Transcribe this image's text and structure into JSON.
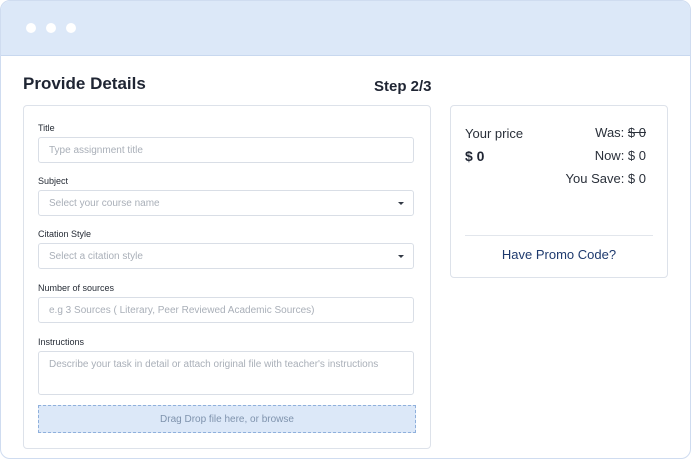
{
  "page": {
    "title": "Provide Details",
    "step": "Step 2/3"
  },
  "form": {
    "title": {
      "label": "Title",
      "placeholder": "Type assignment title",
      "value": ""
    },
    "subject": {
      "label": "Subject",
      "placeholder": "Select your course name",
      "value": ""
    },
    "citation": {
      "label": "Citation Style",
      "placeholder": "Select a citation style",
      "value": ""
    },
    "sources": {
      "label": "Number of sources",
      "placeholder": "e.g 3 Sources ( Literary, Peer Reviewed Academic Sources)",
      "value": ""
    },
    "instructions": {
      "label": "Instructions",
      "placeholder": "Describe your task in detail or attach original file with teacher's instructions",
      "value": ""
    },
    "dropzone": "Drag Drop file here, or browse"
  },
  "price": {
    "your_price_label": "Your price",
    "amount": "$ 0",
    "was_label": "Was:",
    "was_value": "$ 0",
    "now": "Now: $ 0",
    "you_save": "You Save: $ 0",
    "promo": "Have Promo Code?"
  },
  "colors": {
    "titlebar": "#dce8f8",
    "dropzone": "#dce8f8",
    "promo_link": "#1e3a6e"
  },
  "icons": {
    "window_controls": [
      "dot",
      "dot",
      "dot"
    ],
    "dropdown": "caret-down-icon"
  }
}
